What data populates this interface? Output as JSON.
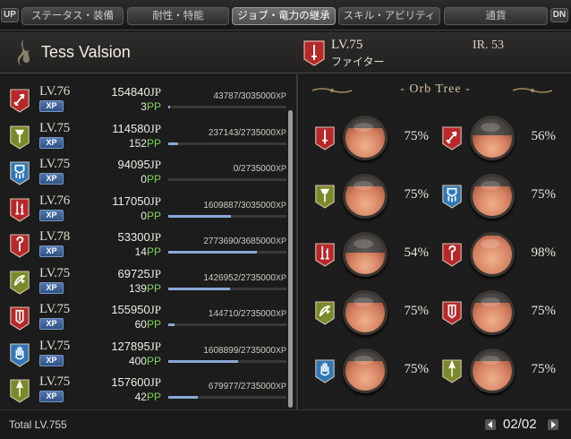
{
  "tabs": {
    "up": "UP",
    "dn": "DN",
    "items": [
      {
        "label": "ステータス・装備"
      },
      {
        "label": "耐性・特能"
      },
      {
        "label": "ジョブ・竜力の継承",
        "active": true
      },
      {
        "label": "スキル・アビリティ"
      },
      {
        "label": "通貨"
      }
    ]
  },
  "header": {
    "character_name": "Tess Valsion",
    "level": "LV.75",
    "job": "ファイター",
    "ir": "IR. 53"
  },
  "jobs": [
    {
      "level": "LV.76",
      "xp_badge": "XP",
      "jp": "154840",
      "jp_unit": "JP",
      "pp": "3",
      "pp_unit": "PP",
      "xp": "43787/3035000",
      "xp_unit": "XP",
      "xp_fraction": 0.014,
      "icon": "arrow-icon",
      "color": "#b8282a"
    },
    {
      "level": "LV.75",
      "xp_badge": "XP",
      "jp": "114580",
      "jp_unit": "JP",
      "pp": "152",
      "pp_unit": "PP",
      "xp": "237143/2735000",
      "xp_unit": "XP",
      "xp_fraction": 0.087,
      "icon": "torch-icon",
      "color": "#7a8a2a"
    },
    {
      "level": "LV.75",
      "xp_badge": "XP",
      "jp": "94095",
      "jp_unit": "JP",
      "pp": "0",
      "pp_unit": "PP",
      "xp": "0/2735000",
      "xp_unit": "XP",
      "xp_fraction": 0.0,
      "icon": "fortress-icon",
      "color": "#2f78b8"
    },
    {
      "level": "LV.76",
      "xp_badge": "XP",
      "jp": "117050",
      "jp_unit": "JP",
      "pp": "0",
      "pp_unit": "PP",
      "xp": "1609887/3035000",
      "xp_unit": "XP",
      "xp_fraction": 0.53,
      "icon": "dual-blade-icon",
      "color": "#b8282a"
    },
    {
      "level": "LV.78",
      "xp_badge": "XP",
      "jp": "53300",
      "jp_unit": "JP",
      "pp": "14",
      "pp_unit": "PP",
      "xp": "2773690/3685000",
      "xp_unit": "XP",
      "xp_fraction": 0.753,
      "icon": "staff-icon",
      "color": "#b8282a"
    },
    {
      "level": "LV.75",
      "xp_badge": "XP",
      "jp": "69725",
      "jp_unit": "JP",
      "pp": "139",
      "pp_unit": "PP",
      "xp": "1426952/2735000",
      "xp_unit": "XP",
      "xp_fraction": 0.522,
      "icon": "bow-icon",
      "color": "#7a8a2a"
    },
    {
      "level": "LV.75",
      "xp_badge": "XP",
      "jp": "155950",
      "jp_unit": "JP",
      "pp": "60",
      "pp_unit": "PP",
      "xp": "144710/2735000",
      "xp_unit": "XP",
      "xp_fraction": 0.053,
      "icon": "shield-icon",
      "color": "#b8282a"
    },
    {
      "level": "LV.75",
      "xp_badge": "XP",
      "jp": "127895",
      "jp_unit": "JP",
      "pp": "400",
      "pp_unit": "PP",
      "xp": "1608899/2735000",
      "xp_unit": "XP",
      "xp_fraction": 0.588,
      "icon": "hand-icon",
      "color": "#2f78b8"
    },
    {
      "level": "LV.75",
      "xp_badge": "XP",
      "jp": "157600",
      "jp_unit": "JP",
      "pp": "42",
      "pp_unit": "PP",
      "xp": "679977/2735000",
      "xp_unit": "XP",
      "xp_fraction": 0.249,
      "icon": "spear-icon",
      "color": "#7a8a2a"
    }
  ],
  "orb_tree": {
    "title": "- Orb Tree -",
    "rows": [
      [
        {
          "icon": "sword-icon",
          "color": "#b8282a",
          "pct": "75%",
          "fill": 0.75
        },
        {
          "icon": "arrow-icon",
          "color": "#b8282a",
          "pct": "56%",
          "fill": 0.56
        }
      ],
      [
        {
          "icon": "torch-icon",
          "color": "#7a8a2a",
          "pct": "75%",
          "fill": 0.75
        },
        {
          "icon": "fortress-icon",
          "color": "#2f78b8",
          "pct": "75%",
          "fill": 0.75
        }
      ],
      [
        {
          "icon": "dual-blade-icon",
          "color": "#b8282a",
          "pct": "54%",
          "fill": 0.54
        },
        {
          "icon": "staff-icon",
          "color": "#b8282a",
          "pct": "98%",
          "fill": 0.98
        }
      ],
      [
        {
          "icon": "bow-icon",
          "color": "#7a8a2a",
          "pct": "75%",
          "fill": 0.75
        },
        {
          "icon": "shield-icon",
          "color": "#b8282a",
          "pct": "75%",
          "fill": 0.75
        }
      ],
      [
        {
          "icon": "hand-icon",
          "color": "#2f78b8",
          "pct": "75%",
          "fill": 0.75
        },
        {
          "icon": "spear-icon",
          "color": "#7a8a2a",
          "pct": "75%",
          "fill": 0.75
        }
      ]
    ]
  },
  "footer": {
    "total": "Total LV.755",
    "page": "02/02"
  }
}
